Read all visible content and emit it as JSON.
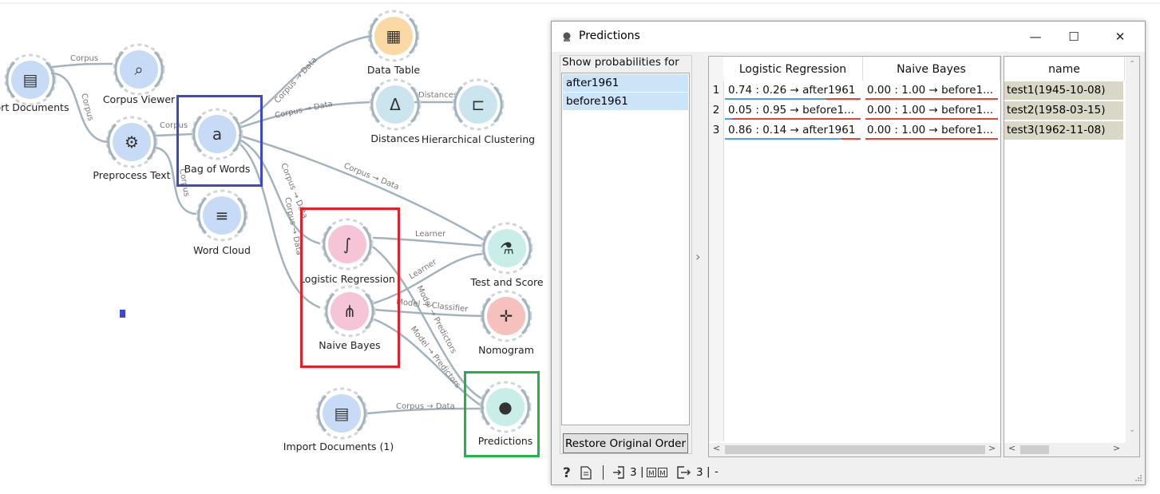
{
  "workflow": {
    "nodes": [
      {
        "id": "import-documents",
        "label": "ort Documents",
        "color": "#c7dbf7"
      },
      {
        "id": "corpus-viewer",
        "label": "Corpus Viewer",
        "color": "#c7dbf7"
      },
      {
        "id": "preprocess-text",
        "label": "Preprocess Text",
        "color": "#c7dbf7"
      },
      {
        "id": "bag-of-words",
        "label": "Bag of Words",
        "color": "#c7dbf7"
      },
      {
        "id": "word-cloud",
        "label": "Word Cloud",
        "color": "#c7dbf7"
      },
      {
        "id": "data-table",
        "label": "Data Table",
        "color": "#fbd9a5"
      },
      {
        "id": "distances",
        "label": "Distances",
        "color": "#cbe5ee"
      },
      {
        "id": "hierarchical-clustering",
        "label": "Hierarchical Clustering",
        "color": "#cbe5ee"
      },
      {
        "id": "logistic-regression",
        "label": "Logistic Regression",
        "color": "#f6c4d7"
      },
      {
        "id": "naive-bayes",
        "label": "Naive Bayes",
        "color": "#f6c4d7"
      },
      {
        "id": "test-and-score",
        "label": "Test and Score",
        "color": "#c9eeea"
      },
      {
        "id": "nomogram",
        "label": "Nomogram",
        "color": "#f6c0bd"
      },
      {
        "id": "import-documents-1",
        "label": "Import Documents (1)",
        "color": "#c7dbf7"
      },
      {
        "id": "predictions",
        "label": "Predictions",
        "color": "#c9eeea"
      }
    ],
    "edge_labels": {
      "e1": "Corpus",
      "e2": "Corpus",
      "e3": "Corpus",
      "e4": "Corpus",
      "e5": "Corpus → Data",
      "e6": "Corpus → Data",
      "e7": "Distances",
      "e8": "Corpus → Data",
      "e9": "Corpus → Data",
      "e10": "Corpus → Data",
      "e11": "Learner",
      "e12": "Learner",
      "e13": "Model → Classifier",
      "e14": "Model → Predictors",
      "e15": "Model → Predictors",
      "e16": "Corpus → Data"
    },
    "highlight_colors": {
      "blue": "#3f48cc",
      "red": "#e0202a",
      "green": "#22b14c"
    }
  },
  "predictions_window": {
    "title": "Predictions",
    "controls": {
      "minimize": "—",
      "maximize": "☐",
      "close": "✕"
    },
    "probabilities": {
      "group_title": "Show probabilities for",
      "items": [
        "after1961",
        "before1961"
      ]
    },
    "restore_button": "Restore Original Order",
    "table": {
      "columns": [
        "Logistic Regression",
        "Naive Bayes"
      ],
      "rows": [
        {
          "num": "1",
          "lr": "0.74 : 0.26 → after1961",
          "nb": "0.00 : 1.00 → before1..."
        },
        {
          "num": "2",
          "lr": "0.05 : 0.95 → before1...",
          "nb": "0.00 : 1.00 → before1..."
        },
        {
          "num": "3",
          "lr": "0.86 : 0.14 → after1961",
          "nb": "0.00 : 1.00 → before1..."
        }
      ],
      "bar_colors": {
        "after": "#4ba3db",
        "before": "#e0483c"
      }
    },
    "data_table": {
      "column": "name",
      "values": [
        "test1(1945-10-08)",
        "test2(1958-03-15)",
        "test3(1962-11-08)"
      ]
    },
    "status": {
      "input_count": "3",
      "output_count": "3",
      "sep1": "|",
      "sep2": "|",
      "trail": "-"
    }
  }
}
